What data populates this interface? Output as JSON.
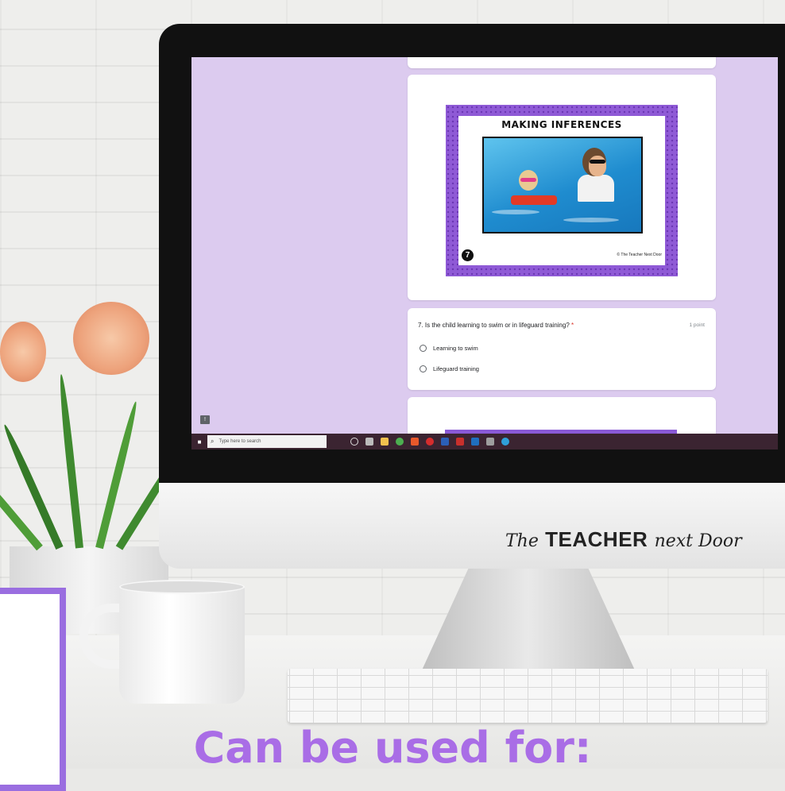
{
  "form": {
    "slide": {
      "title": "MAKING INFERENCES",
      "number": "7",
      "credit": "© The Teacher Next Door"
    },
    "question": {
      "text": "7. Is the child learning to swim or in lifeguard training?",
      "required_mark": "*",
      "points": "1 point",
      "options": [
        "Learning to swim",
        "Lifeguard training"
      ]
    }
  },
  "taskbar": {
    "search_placeholder": "Type here to search",
    "app_icons": [
      "task-view-icon",
      "file-explorer-icon",
      "chrome-icon",
      "office-icon",
      "opera-icon",
      "word-icon",
      "acrobat-icon",
      "photoshop-icon",
      "onenote-icon",
      "edge-icon"
    ]
  },
  "brand": {
    "script_1": "The",
    "bold": "TEACHER",
    "script_2": "next Door"
  },
  "caption": "Can be used for:",
  "colors": {
    "form_background": "#dccbef",
    "accent_purple": "#8f5ad6",
    "caption_purple": "#a96de6",
    "taskbar": "#3b2431"
  }
}
